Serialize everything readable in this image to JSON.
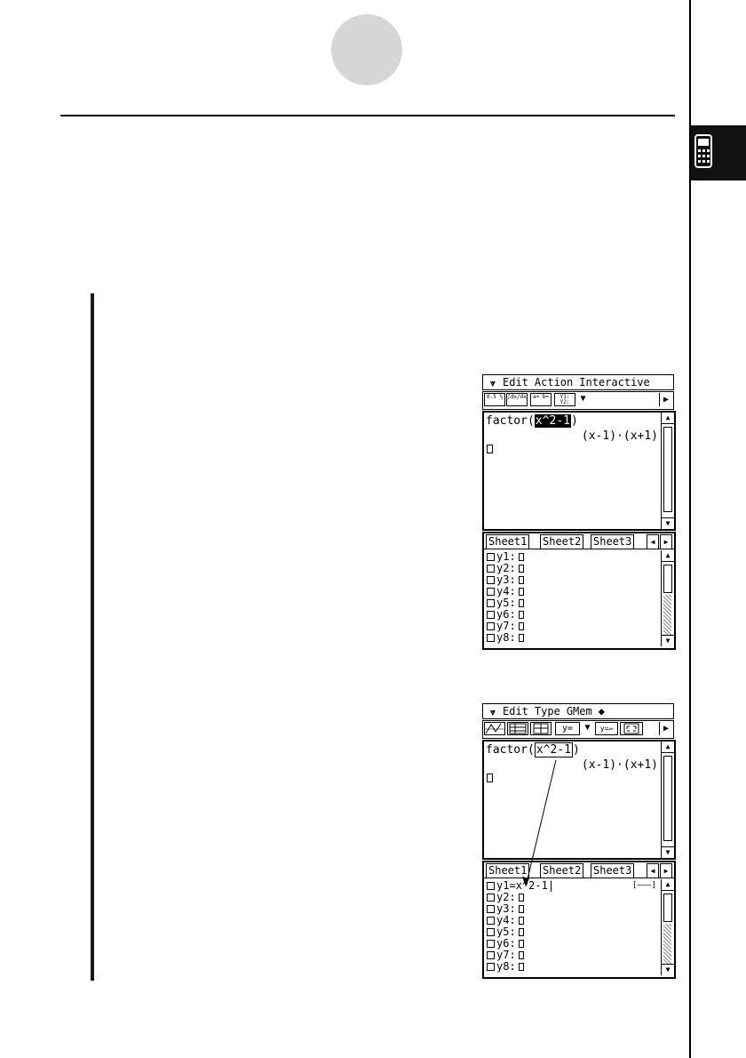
{
  "screen1": {
    "menu": [
      "Edit",
      "Action",
      "Interactive"
    ],
    "toolbar_buttons": [
      "0.5 ⅓",
      "∫dx/dx",
      "a= b=",
      "Y1: Y2:"
    ],
    "entry_prefix": "factor(",
    "entry_highlight": "x^2-1",
    "entry_suffix": ")",
    "result": "(x-1)·(x+1)",
    "tabs": [
      "Sheet1",
      "Sheet2",
      "Sheet3"
    ],
    "functions": [
      "y1:",
      "y2:",
      "y3:",
      "y4:",
      "y5:",
      "y6:",
      "y7:",
      "y8:"
    ]
  },
  "screen2": {
    "menu": [
      "Edit",
      "Type",
      "GMem",
      "◆"
    ],
    "toolbar_buttons": [
      "y=",
      "y=▱"
    ],
    "entry_prefix": "factor(",
    "entry_highlight": "x^2-1",
    "entry_suffix": ")",
    "result": "(x-1)·(x+1)",
    "tabs": [
      "Sheet1",
      "Sheet2",
      "Sheet3"
    ],
    "y1_label": "y1=",
    "y1_expr": "x^2-1",
    "range_label": "[———]",
    "functions": [
      "y2:",
      "y3:",
      "y4:",
      "y5:",
      "y6:",
      "y7:",
      "y8:"
    ]
  }
}
